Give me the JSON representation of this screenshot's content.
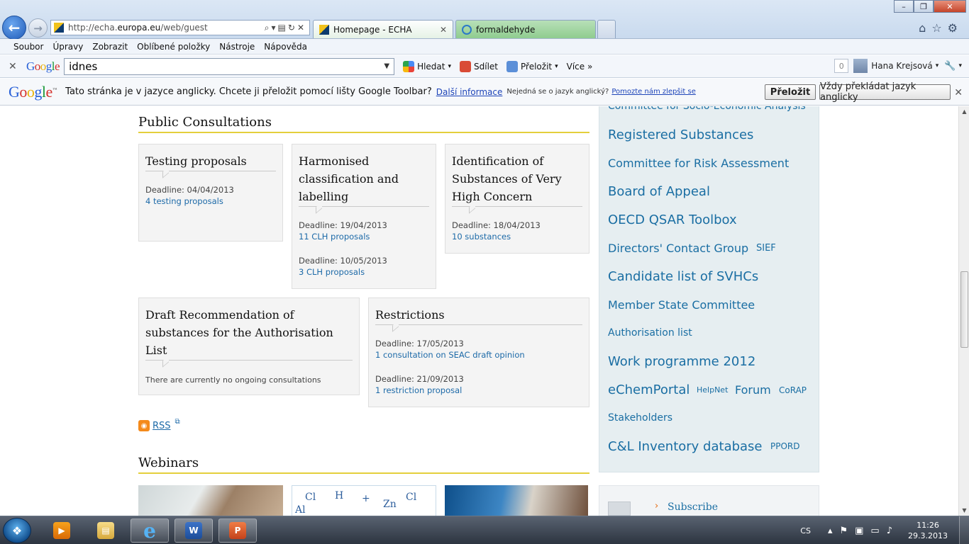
{
  "browser": {
    "address_url_prefix": "http://echa.",
    "address_url_domain": "europa.eu",
    "address_url_suffix": "/web/guest",
    "tabs": [
      {
        "label": "Homepage - ECHA"
      },
      {
        "label": "formaldehyde"
      }
    ],
    "menu": [
      "Soubor",
      "Úpravy",
      "Zobrazit",
      "Oblíbené položky",
      "Nástroje",
      "Nápověda"
    ]
  },
  "google_toolbar": {
    "logo": [
      "G",
      "o",
      "o",
      "g",
      "l",
      "e"
    ],
    "search_value": "idnes",
    "search_label": "Hledat",
    "share_label": "Sdílet",
    "translate_label": "Přeložit",
    "more_label": "Více »",
    "count": "0",
    "user": "Hana Krejsová"
  },
  "translate_bar": {
    "message": "Tato stránka je v jazyce anglicky. Chcete ji přeložit pomocí lišty Google Toolbar?",
    "more_info": "Další informace",
    "not_lang": "Nejedná se o jazyk anglický?",
    "help": "Pomozte nám zlepšit se",
    "translate_button": "Přeložit",
    "always_button": "Vždy překládat jazyk anglicky"
  },
  "consultations": {
    "title": "Public Consultations",
    "boxes": [
      {
        "title": "Testing proposals",
        "entries": [
          {
            "deadline": "Deadline: 04/04/2013",
            "link": "4 testing proposals"
          }
        ]
      },
      {
        "title": "Harmonised classification and labelling",
        "entries": [
          {
            "deadline": "Deadline: 19/04/2013",
            "link": "11 CLH proposals"
          },
          {
            "deadline": "Deadline: 10/05/2013",
            "link": "3 CLH proposals"
          }
        ]
      },
      {
        "title": "Identification of Substances of Very High Concern",
        "entries": [
          {
            "deadline": "Deadline: 18/04/2013",
            "link": "10 substances"
          }
        ]
      },
      {
        "title": "Draft Recommendation of substances for the Authorisation List",
        "note": "There are currently no ongoing consultations"
      },
      {
        "title": "Restrictions",
        "entries": [
          {
            "deadline": "Deadline: 17/05/2013",
            "link": "1 consultation on SEAC draft opinion"
          },
          {
            "deadline": "Deadline: 21/09/2013",
            "link": "1 restriction proposal"
          }
        ]
      }
    ],
    "rss": "RSS"
  },
  "webinars": {
    "title": "Webinars",
    "thumb2_text": [
      "Cl",
      "Al",
      "Zn",
      "Cl",
      "+",
      "H"
    ]
  },
  "tag_cloud": [
    "Committee for Socio-Economic Analysis",
    "Registered Substances",
    "Committee for Risk Assessment",
    "Board of Appeal",
    "OECD QSAR Toolbox",
    "Directors' Contact Group",
    "SIEF",
    "Candidate list of SVHCs",
    "Member State Committee",
    "Authorisation list",
    "Work programme 2012",
    "eChemPortal",
    "HelpNet",
    "Forum",
    "CoRAP",
    "Stakeholders",
    "C&L Inventory database",
    "PPORD"
  ],
  "subscribe": "Subscribe",
  "taskbar": {
    "lang": "CS",
    "time": "11:26",
    "date": "29.3.2013",
    "start_glyph": "❖",
    "app_glyphs": {
      "media": "▶",
      "folder": "▤",
      "ie": "e",
      "word": "W",
      "ppt": "P"
    }
  },
  "icons": {
    "back": "arrow-left-icon",
    "forward": "arrow-right-icon",
    "search": "magnifier-icon",
    "refresh": "refresh-icon",
    "stop": "close-icon",
    "home": "home-icon",
    "favorites": "star-icon",
    "tools": "gear-icon"
  },
  "colors": {
    "link": "#1a6ea3",
    "section_rule": "#e4cf3c",
    "cloud_bg": "#e6eef1",
    "active_tab": "#8fcc8f"
  }
}
